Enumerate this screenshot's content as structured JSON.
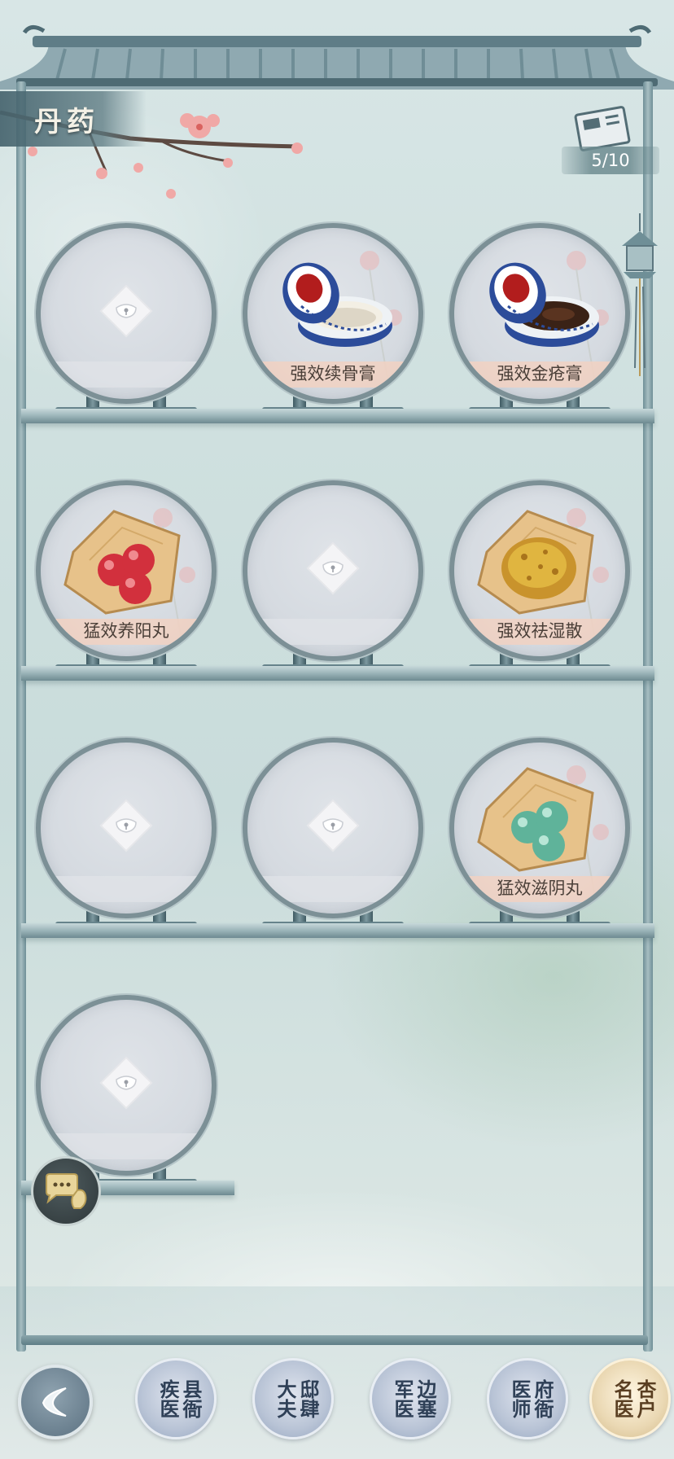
{
  "header": {
    "title": "丹药",
    "counter": "5/10"
  },
  "shelves": [
    {
      "items": [
        {
          "name": "",
          "unlocked": false
        },
        {
          "name": "强效续骨膏",
          "unlocked": true,
          "art": "jar-white"
        },
        {
          "name": "强效金疮膏",
          "unlocked": true,
          "art": "jar-brown"
        }
      ]
    },
    {
      "items": [
        {
          "name": "猛效养阳丸",
          "unlocked": true,
          "art": "pills-red"
        },
        {
          "name": "",
          "unlocked": false
        },
        {
          "name": "强效祛湿散",
          "unlocked": true,
          "art": "powder-yellow"
        }
      ]
    },
    {
      "items": [
        {
          "name": "",
          "unlocked": false
        },
        {
          "name": "",
          "unlocked": false
        },
        {
          "name": "猛效滋阴丸",
          "unlocked": true,
          "art": "pills-green"
        }
      ]
    },
    {
      "items": [
        {
          "name": "",
          "unlocked": false
        }
      ]
    }
  ],
  "nav": {
    "back_icon": "back-arrow-icon",
    "tabs": [
      {
        "label": "县衙疾医",
        "active": false
      },
      {
        "label": "邸肆大夫",
        "active": false
      },
      {
        "label": "边塞军医",
        "active": false
      },
      {
        "label": "府衙医师",
        "active": false
      },
      {
        "label": "杏户名医",
        "active": true
      }
    ]
  },
  "chat_icon": "chat-bubble-icon",
  "colors": {
    "frame": "#6f8f97",
    "label_band": "#f0d2c3",
    "tab_active": "#ead8b3",
    "tab_inactive": "#b9c4d6"
  }
}
